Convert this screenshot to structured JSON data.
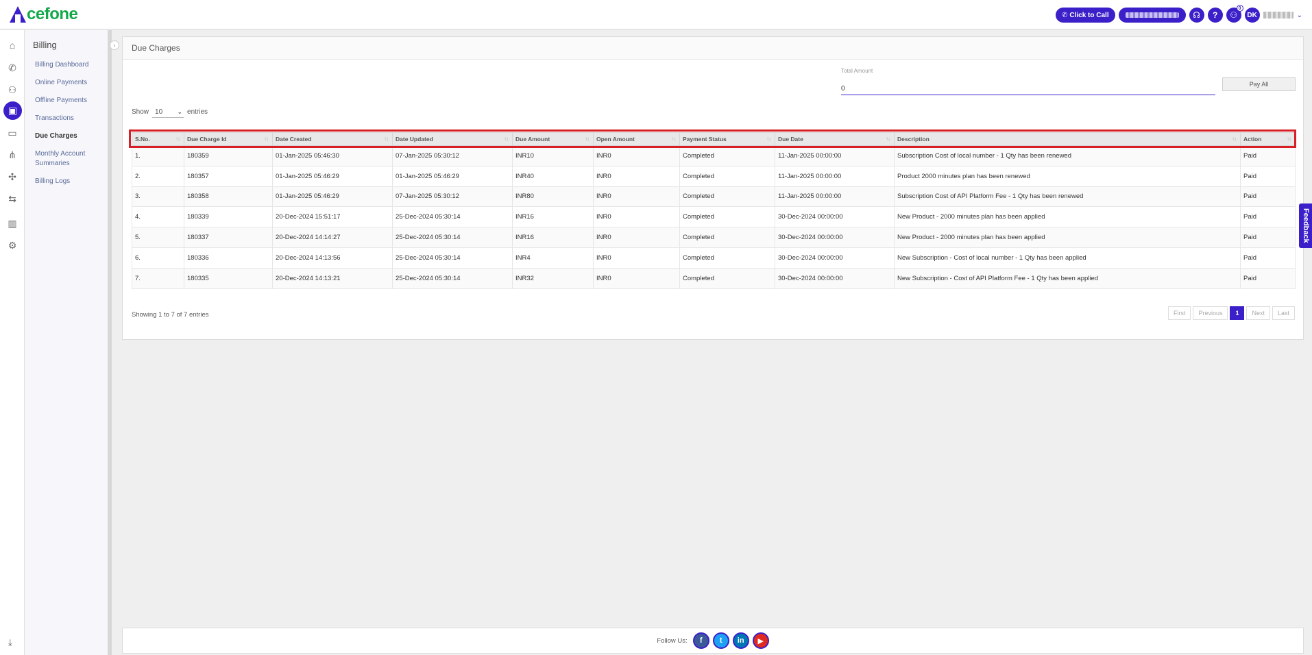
{
  "brand": {
    "logo_text": "cefone",
    "brand_color": "#3b1fc9",
    "logo_green": "#14a84b"
  },
  "topbar": {
    "call_label": "Click to Call",
    "help_label": "?",
    "notifications_count": "0",
    "avatar_initials": "DK"
  },
  "rail": {
    "icons": [
      "home-icon",
      "phone-icon",
      "users-icon",
      "wallet-icon",
      "monitor-icon",
      "network-icon",
      "puzzle-icon",
      "routing-icon",
      "chart-icon",
      "settings-icon"
    ],
    "active": "wallet-icon"
  },
  "submenu": {
    "title": "Billing",
    "items": [
      {
        "label": "Billing Dashboard"
      },
      {
        "label": "Online Payments"
      },
      {
        "label": "Offline Payments"
      },
      {
        "label": "Transactions"
      },
      {
        "label": "Due Charges",
        "active": true
      },
      {
        "label": "Monthly Account Summaries"
      },
      {
        "label": "Billing Logs"
      }
    ]
  },
  "main": {
    "title": "Due Charges",
    "total_amount_label": "Total Amount",
    "total_amount_value": "0",
    "pay_all_label": "Pay All",
    "show_label": "Show",
    "entries_value": "10",
    "entries_label": "entries",
    "columns": [
      "S.No.",
      "Due Charge Id",
      "Date Created",
      "Date Updated",
      "Due Amount",
      "Open Amount",
      "Payment Status",
      "Due Date",
      "Description",
      "Action"
    ],
    "rows": [
      [
        "1.",
        "180359",
        "01-Jan-2025 05:46:30",
        "07-Jan-2025 05:30:12",
        "INR10",
        "INR0",
        "Completed",
        "11-Jan-2025 00:00:00",
        "Subscription Cost of local number - 1 Qty has been renewed",
        "Paid"
      ],
      [
        "2.",
        "180357",
        "01-Jan-2025 05:46:29",
        "01-Jan-2025 05:46:29",
        "INR40",
        "INR0",
        "Completed",
        "11-Jan-2025 00:00:00",
        "Product 2000 minutes plan has been renewed",
        "Paid"
      ],
      [
        "3.",
        "180358",
        "01-Jan-2025 05:46:29",
        "07-Jan-2025 05:30:12",
        "INR80",
        "INR0",
        "Completed",
        "11-Jan-2025 00:00:00",
        "Subscription Cost of API Platform Fee - 1 Qty has been renewed",
        "Paid"
      ],
      [
        "4.",
        "180339",
        "20-Dec-2024 15:51:17",
        "25-Dec-2024 05:30:14",
        "INR16",
        "INR0",
        "Completed",
        "30-Dec-2024 00:00:00",
        "New Product - 2000 minutes plan has been applied",
        "Paid"
      ],
      [
        "5.",
        "180337",
        "20-Dec-2024 14:14:27",
        "25-Dec-2024 05:30:14",
        "INR16",
        "INR0",
        "Completed",
        "30-Dec-2024 00:00:00",
        "New Product - 2000 minutes plan has been applied",
        "Paid"
      ],
      [
        "6.",
        "180336",
        "20-Dec-2024 14:13:56",
        "25-Dec-2024 05:30:14",
        "INR4",
        "INR0",
        "Completed",
        "30-Dec-2024 00:00:00",
        "New Subscription - Cost of local number - 1 Qty has been applied",
        "Paid"
      ],
      [
        "7.",
        "180335",
        "20-Dec-2024 14:13:21",
        "25-Dec-2024 05:30:14",
        "INR32",
        "INR0",
        "Completed",
        "30-Dec-2024 00:00:00",
        "New Subscription - Cost of API Platform Fee - 1 Qty has been applied",
        "Paid"
      ]
    ],
    "showing_text": "Showing 1 to 7 of 7 entries",
    "pager": [
      "First",
      "Previous",
      "1",
      "Next",
      "Last"
    ],
    "pager_active": "1"
  },
  "feedback_label": "Feedback",
  "footer": {
    "follow_label": "Follow Us:",
    "socials": [
      {
        "icon": "facebook-icon",
        "glyph": "f",
        "color": "#3b5998"
      },
      {
        "icon": "twitter-icon",
        "glyph": "t",
        "color": "#1da1f2"
      },
      {
        "icon": "linkedin-icon",
        "glyph": "in",
        "color": "#0077b5"
      },
      {
        "icon": "youtube-icon",
        "glyph": "▶",
        "color": "#e02a20"
      }
    ]
  }
}
